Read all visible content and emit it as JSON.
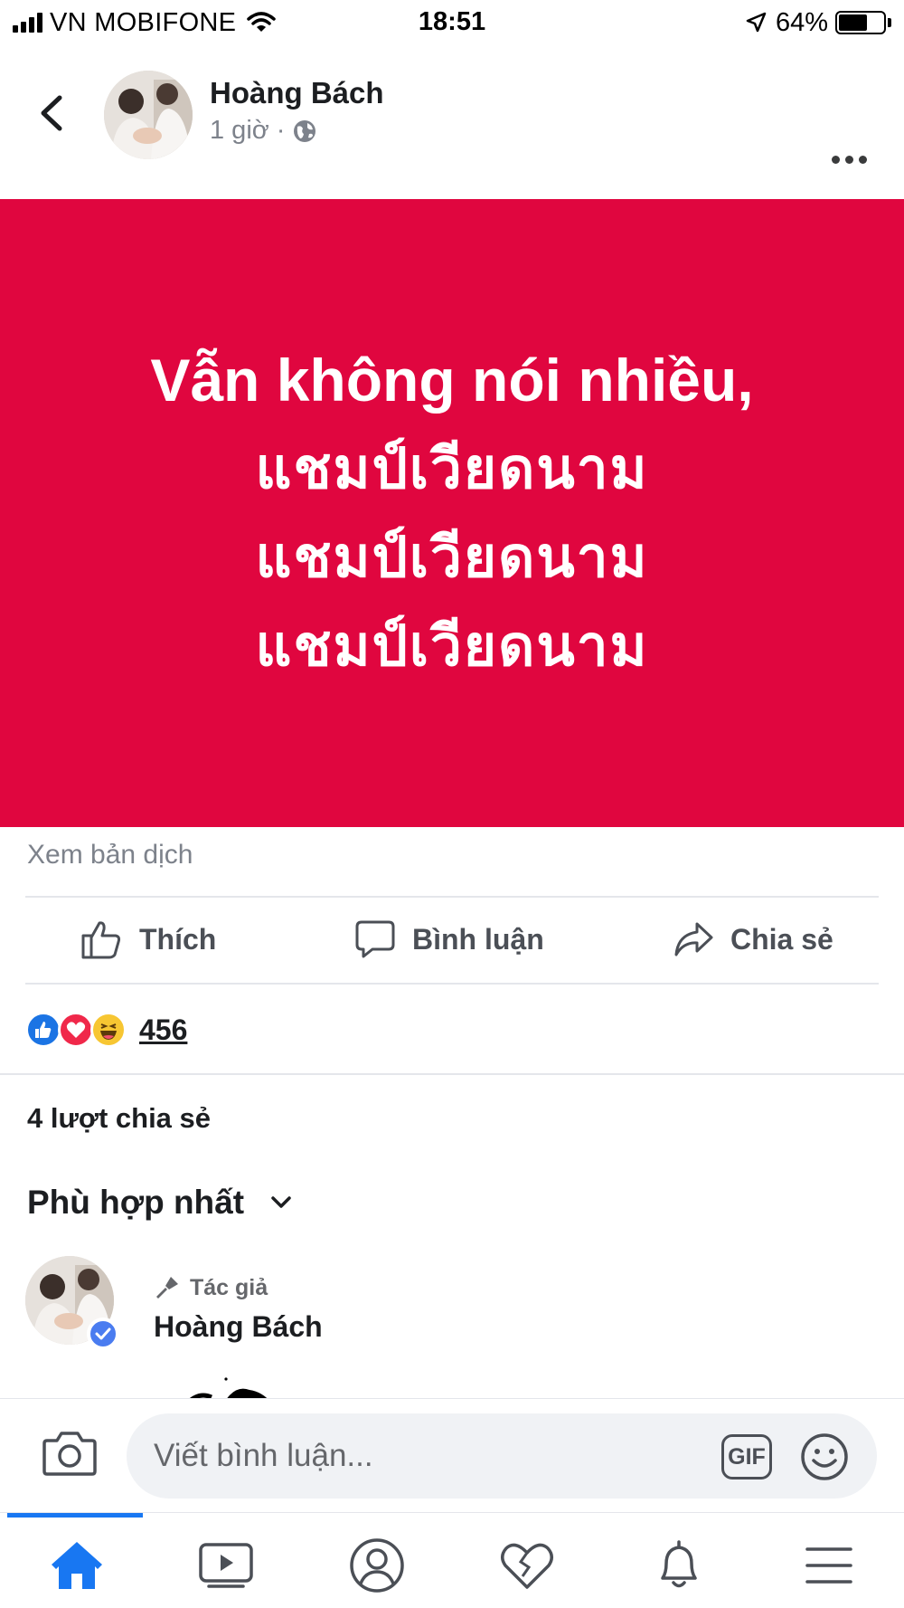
{
  "status_bar": {
    "carrier": "VN MOBIFONE",
    "time": "18:51",
    "battery_percent": "64%",
    "battery_level": 0.64
  },
  "post": {
    "author": "Hoàng Bách",
    "time_ago": "1 giờ",
    "separator": "·",
    "privacy_icon": "globe-icon",
    "image_lines": [
      "Vẫn không nói nhiều,",
      "แชมป์เวียดนาม",
      "แชมป์เวียดนาม",
      "แชมป์เวียดนาม"
    ],
    "image_background": "#e0063f",
    "translate_label": "Xem bản dịch"
  },
  "actions": {
    "like": "Thích",
    "comment": "Bình luận",
    "share": "Chia sẻ"
  },
  "reactions": {
    "icons": [
      "like-icon",
      "love-icon",
      "haha-icon"
    ],
    "count": "456"
  },
  "shares_label": "4 lượt chia sẻ",
  "sort_label": "Phù hợp nhất",
  "comment": {
    "badge": "Tác giả",
    "author": "Hoàng Bách"
  },
  "composer": {
    "placeholder": "Viết bình luận...",
    "gif_label": "GIF"
  },
  "tabs": [
    "home-icon",
    "video-icon",
    "profile-icon",
    "dating-icon",
    "notifications-icon",
    "menu-icon"
  ],
  "colors": {
    "accent": "#1877f2",
    "text_secondary": "#65676b"
  }
}
